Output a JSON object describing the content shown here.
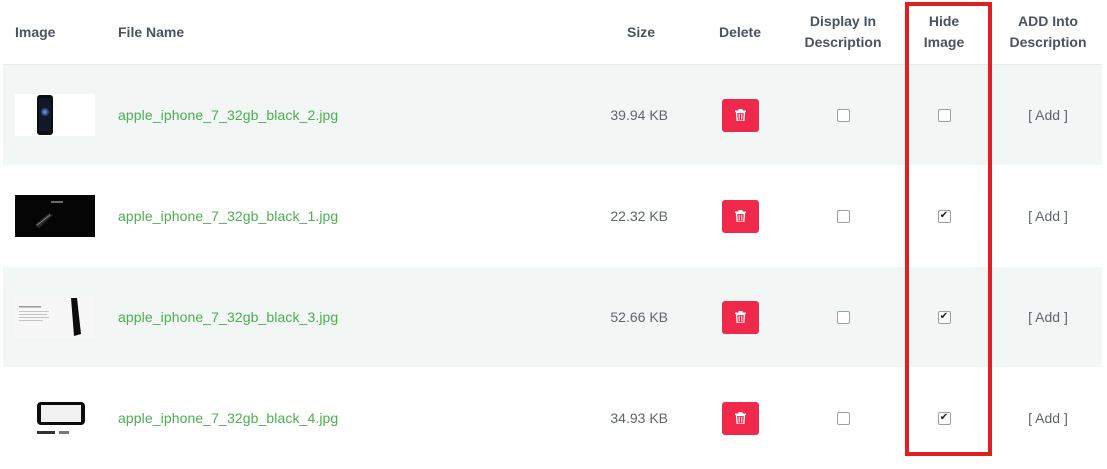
{
  "headers": {
    "image": "Image",
    "file_name": "File Name",
    "size": "Size",
    "delete": "Delete",
    "display_line1": "Display In",
    "display_line2": "Description",
    "hide_line1": "Hide",
    "hide_line2": "Image",
    "add_line1": "ADD Into",
    "add_line2": "Description"
  },
  "rows": [
    {
      "file_name": "apple_iphone_7_32gb_black_2.jpg",
      "size": "39.94 KB",
      "display_in_description": false,
      "hide_image": false,
      "add_label": "[ Add ]"
    },
    {
      "file_name": "apple_iphone_7_32gb_black_1.jpg",
      "size": "22.32 KB",
      "display_in_description": false,
      "hide_image": true,
      "add_label": "[ Add ]"
    },
    {
      "file_name": "apple_iphone_7_32gb_black_3.jpg",
      "size": "52.66 KB",
      "display_in_description": false,
      "hide_image": true,
      "add_label": "[ Add ]"
    },
    {
      "file_name": "apple_iphone_7_32gb_black_4.jpg",
      "size": "34.93 KB",
      "display_in_description": false,
      "hide_image": true,
      "add_label": "[ Add ]"
    }
  ],
  "colors": {
    "delete_button": "#f0284a",
    "file_link": "#4caf50",
    "row_stripe": "#f2f6f4",
    "highlight_box": "#e02020"
  },
  "icons": {
    "delete": "trash-icon",
    "checked": "checkmark-icon"
  }
}
